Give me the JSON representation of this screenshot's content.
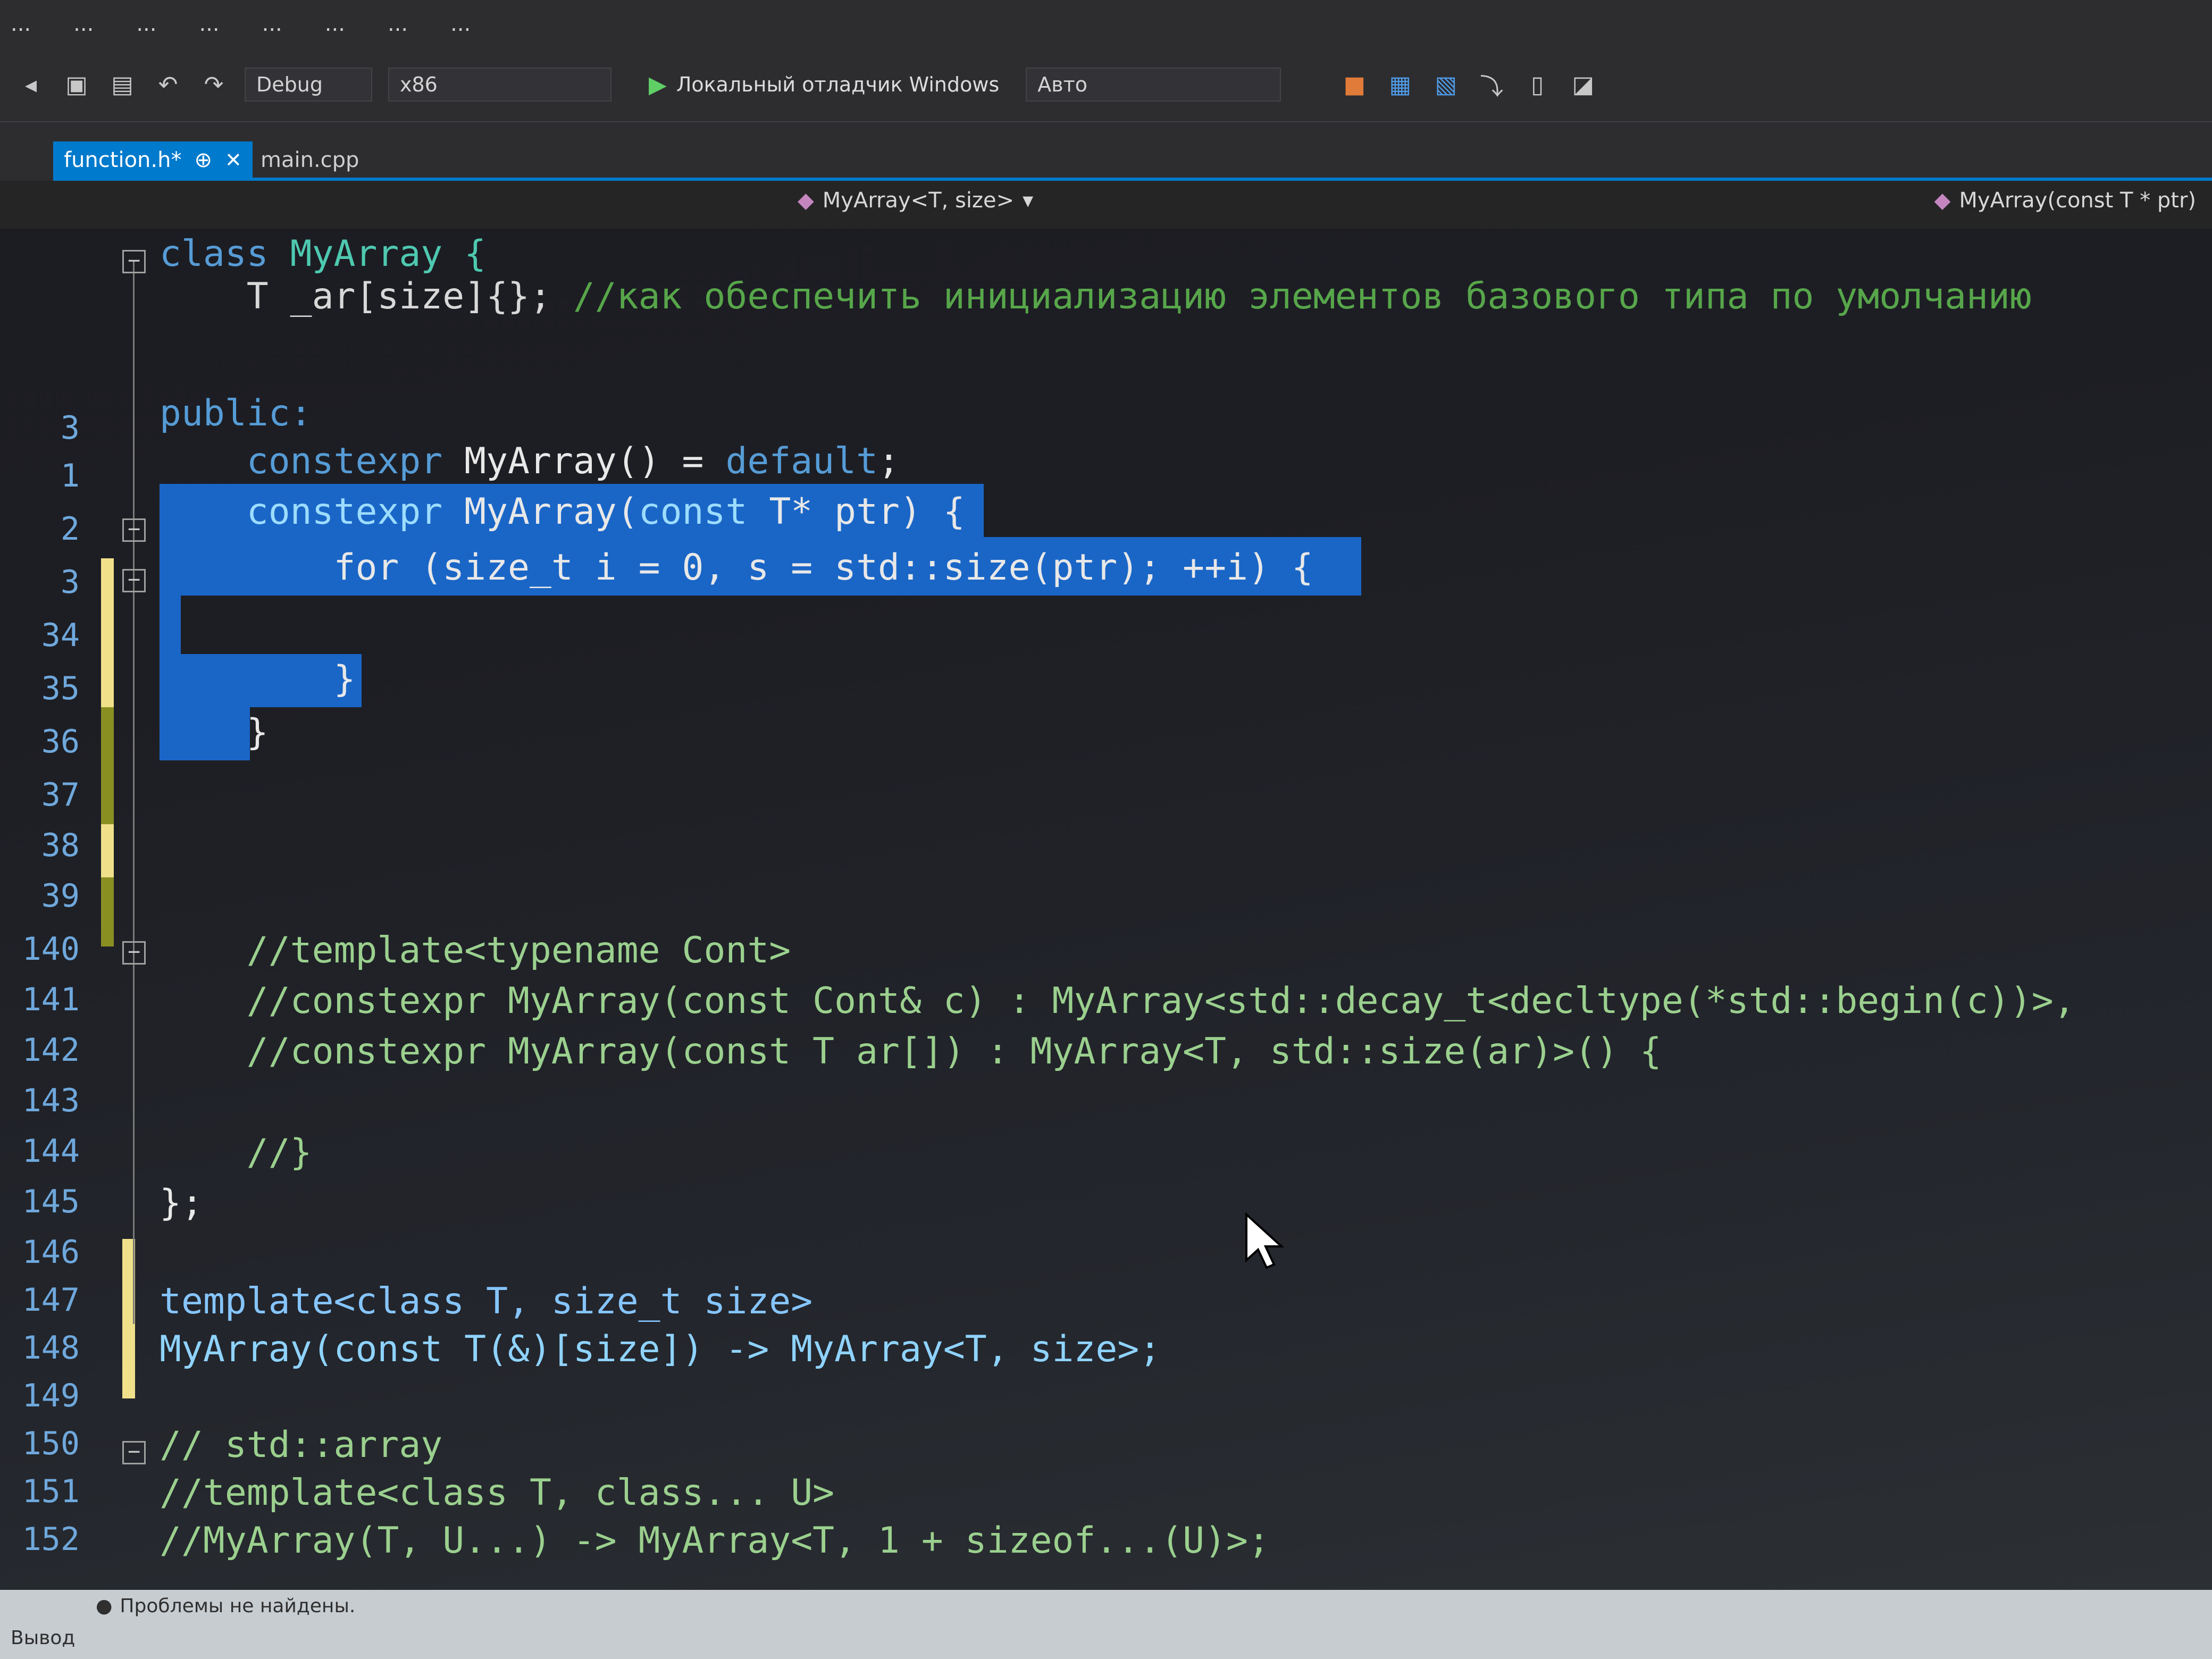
{
  "window": {
    "menu": [
      "...",
      "...",
      "...",
      "...",
      "...",
      "...",
      "...",
      "..."
    ]
  },
  "toolbar": {
    "config_combo": "Debug",
    "platform_combo": "x86",
    "run_label": "Локальный отладчик Windows",
    "run_mode": "Авто"
  },
  "tabs": {
    "active": "function.h*",
    "active_pin": "⊕",
    "active_close": "✕",
    "inactive": "main.cpp"
  },
  "navbar": {
    "scope": "MyArray<T, size>",
    "member": "MyArray(const T * ptr)"
  },
  "gutter": {
    "line_numbers": [
      "",
      "",
      "",
      "",
      "",
      "",
      "",
      "",
      "",
      "",
      "",
      "",
      "",
      "140",
      "141",
      "142",
      "143",
      "144",
      "145",
      "146",
      "147",
      "148",
      "149",
      "150",
      "151",
      "152"
    ],
    "visible_numbers": [
      "3",
      "1",
      "2",
      "3",
      "34",
      "35",
      "36",
      "37",
      "38",
      "39",
      "140",
      "141",
      "142",
      "143",
      "144",
      "145",
      "146",
      "147",
      "148",
      "149",
      "150",
      "151",
      "152"
    ]
  },
  "code": {
    "l1_kw": "class",
    "l1_name": " MyArray {",
    "l2_text": "    T _ar[size]{}; ",
    "l2_comment": "//как обеспечить инициализацию элементов базового типа по умолчанию",
    "l4": "public:",
    "l5_kw": "    constexpr",
    "l5_rest": " MyArray() = ",
    "l5_default": "default",
    "l5_end": ";",
    "l6_kw": "    constexpr",
    "l6_rest": " MyArray(",
    "l6_const": "const",
    "l6_tail": " T* ptr) {",
    "l7_for": "        for",
    "l7_rest": " (size_t i = 0, s = std::size(ptr); ++i) {",
    "l9": "        }",
    "l10": "    }",
    "l14": "    //template<typename Cont>",
    "l15": "    //constexpr MyArray(const Cont& c) : MyArray<std::decay_t<decltype(*std::begin(c))>,",
    "l16": "    //constexpr MyArray(const T ar[]) : MyArray<T, std::size(ar)>() {",
    "l18": "    //}",
    "l19": "};",
    "l21": "template<class T, size_t size>",
    "l22": "MyArray(const T(&)[size]) -> MyArray<T, size>;",
    "l24": "// std::array",
    "l25": "//template<class T, class... U>",
    "l26": "//MyArray(T, U...) -> MyArray<T, 1 + sizeof...(U)>;"
  },
  "status": {
    "problems": "Проблемы не найдены.",
    "left": "Вывод"
  },
  "colors": {
    "selection": "#1a66c7",
    "keyword": "#569cd6",
    "comment": "#57a64a",
    "change_saved": "#b5b100",
    "change_unsaved": "#f0e08a"
  }
}
